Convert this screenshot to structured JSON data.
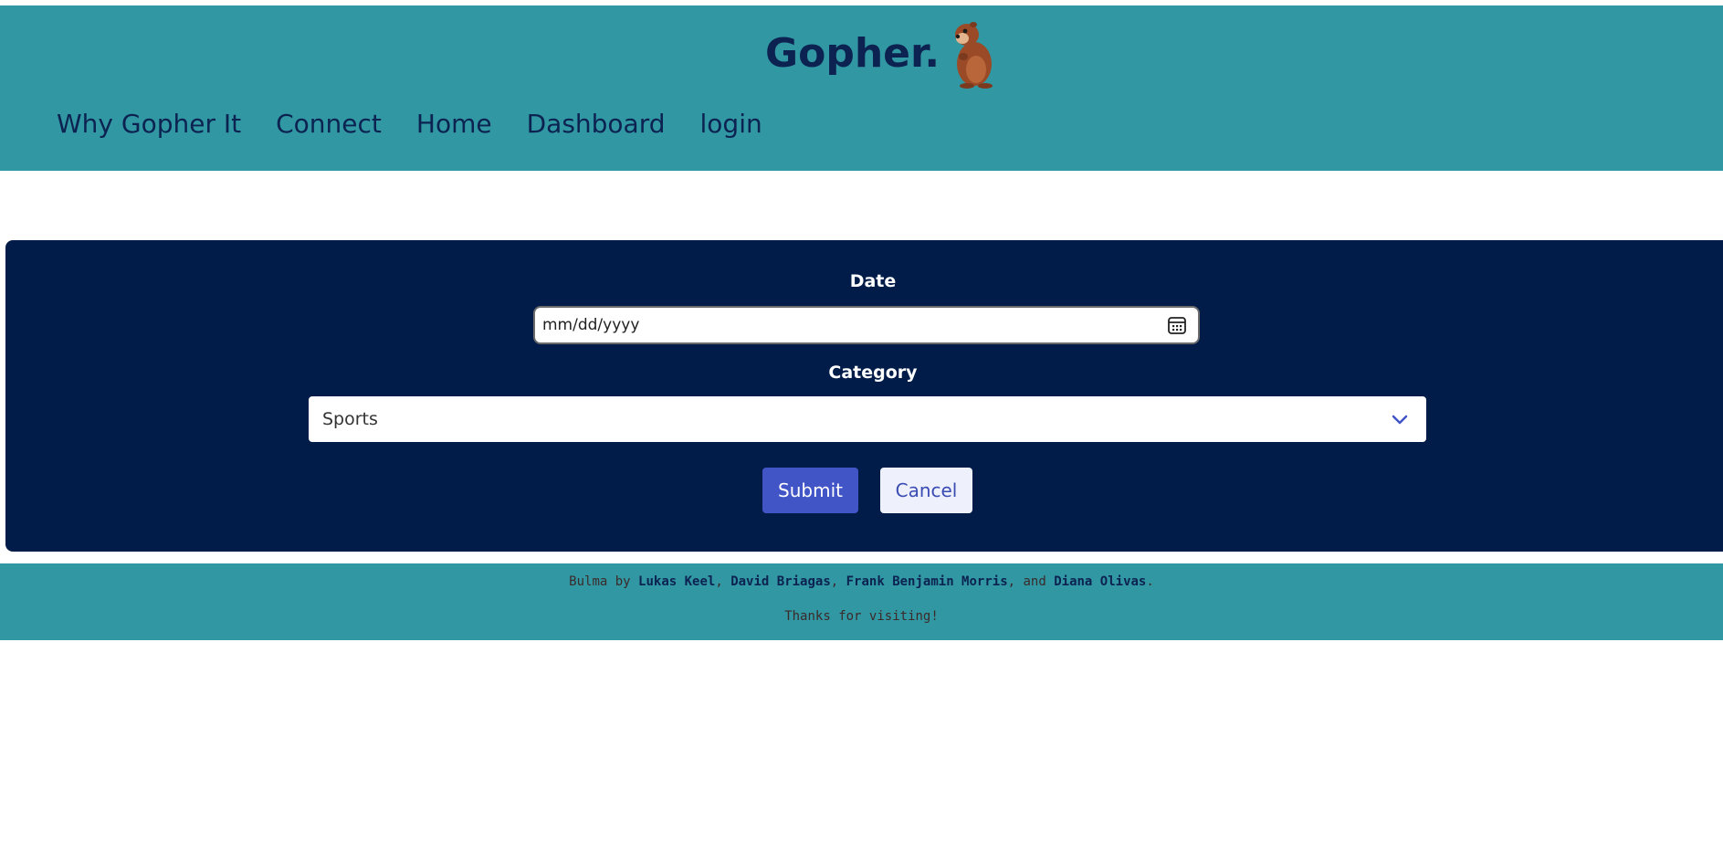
{
  "brand": {
    "name": "Gopher."
  },
  "nav": {
    "items": [
      {
        "label": "Why Gopher It"
      },
      {
        "label": "Connect"
      },
      {
        "label": "Home"
      },
      {
        "label": "Dashboard"
      },
      {
        "label": "login"
      }
    ]
  },
  "form": {
    "date_label": "Date",
    "date_placeholder": "mm/dd/yyyy",
    "category_label": "Category",
    "category_selected": "Sports",
    "submit_label": "Submit",
    "cancel_label": "Cancel"
  },
  "footer": {
    "prefix": "Bulma by ",
    "authors": [
      "Lukas Keel",
      "David Briagas",
      "Frank Benjamin Morris",
      "Diana Olivas"
    ],
    "sep1": ", ",
    "sep2": ", ",
    "sep3": ", and ",
    "suffix": ".",
    "thanks": "Thanks for visiting!"
  },
  "colors": {
    "header_bg": "#3197a2",
    "panel_bg": "#011c49",
    "nav_text": "#0c2351",
    "submit_bg": "#4255c7",
    "cancel_bg": "#eef1fb"
  },
  "icons": {
    "logo": "gopher-logo-icon",
    "calendar": "calendar-icon",
    "chevron": "chevron-down-icon"
  }
}
